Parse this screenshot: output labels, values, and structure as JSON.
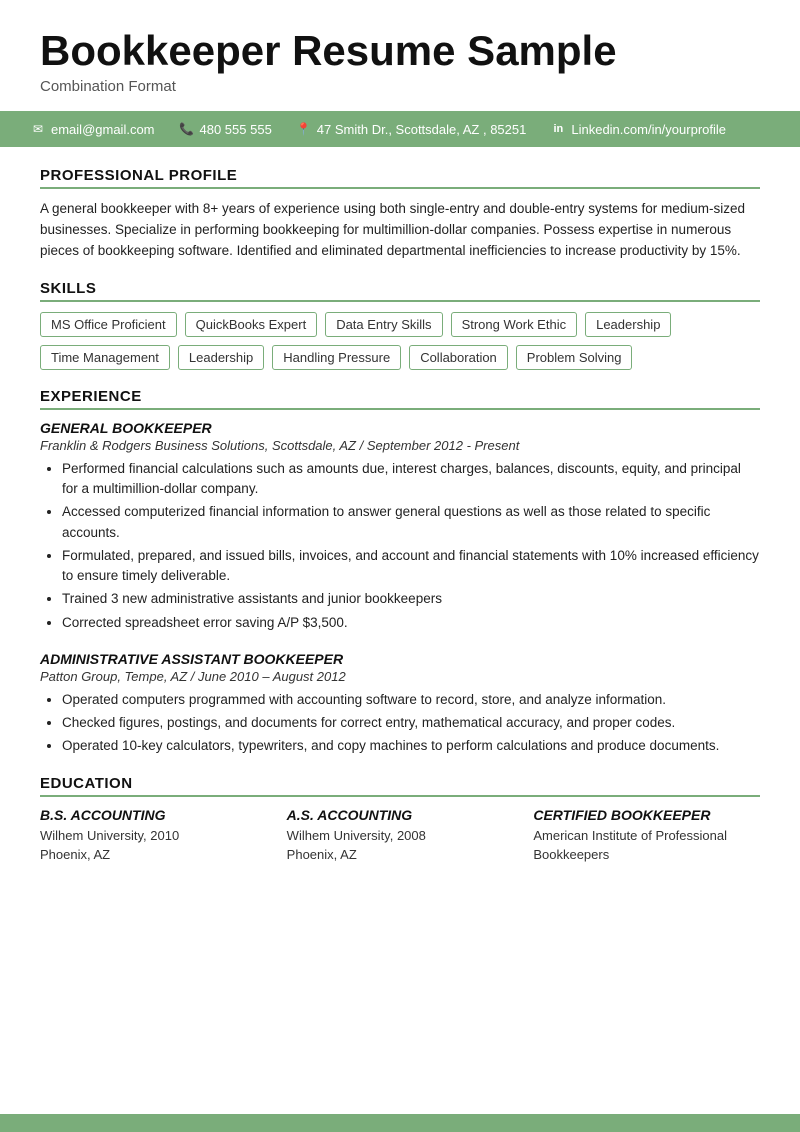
{
  "header": {
    "title": "Bookkeeper Resume Sample",
    "subtitle": "Combination Format"
  },
  "contact": {
    "email": "email@gmail.com",
    "phone": "480 555 555",
    "address": "47 Smith Dr., Scottsdale, AZ , 85251",
    "linkedin": "Linkedin.com/in/yourprofile"
  },
  "sections": {
    "profile": {
      "label": "PROFESSIONAL PROFILE",
      "text": "A general bookkeeper with 8+ years of experience using both single-entry and double-entry systems for medium-sized businesses. Specialize in performing bookkeeping for multimillion-dollar companies. Possess expertise in numerous pieces of bookkeeping software. Identified and eliminated departmental inefficiencies to increase productivity by 15%."
    },
    "skills": {
      "label": "SKILLS",
      "items": [
        "MS Office Proficient",
        "QuickBooks Expert",
        "Data Entry Skills",
        "Strong Work Ethic",
        "Leadership",
        "Time Management",
        "Leadership",
        "Handling Pressure",
        "Collaboration",
        "Problem Solving"
      ]
    },
    "experience": {
      "label": "EXPERIENCE",
      "entries": [
        {
          "title": "GENERAL BOOKKEEPER",
          "company": "Franklin & Rodgers Business Solutions, Scottsdale, AZ  /  September 2012 - Present",
          "bullets": [
            "Performed financial calculations such as amounts due, interest charges, balances, discounts, equity, and principal for a multimillion-dollar company.",
            "Accessed computerized financial information to answer general questions as well as those related to specific accounts.",
            "Formulated, prepared, and issued bills, invoices, and account and financial statements with 10% increased efficiency to ensure timely deliverable.",
            "Trained 3 new administrative assistants and junior bookkeepers",
            "Corrected spreadsheet error saving A/P $3,500."
          ]
        },
        {
          "title": "ADMINISTRATIVE ASSISTANT BOOKKEEPER",
          "company": "Patton Group, Tempe, AZ  /  June 2010 – August 2012",
          "bullets": [
            "Operated computers programmed with accounting software to record, store, and analyze information.",
            "Checked figures, postings, and documents for correct entry, mathematical accuracy, and proper codes.",
            "Operated 10-key calculators, typewriters, and copy machines to perform calculations and produce documents."
          ]
        }
      ]
    },
    "education": {
      "label": "EDUCATION",
      "entries": [
        {
          "degree": "B.S. ACCOUNTING",
          "line1": "Wilhem University, 2010",
          "line2": "Phoenix, AZ"
        },
        {
          "degree": "A.S. ACCOUNTING",
          "line1": "Wilhem University, 2008",
          "line2": "Phoenix, AZ"
        },
        {
          "degree": "CERTIFIED BOOKKEEPER",
          "line1": "American Institute of Professional Bookkeepers",
          "line2": ""
        }
      ]
    }
  }
}
